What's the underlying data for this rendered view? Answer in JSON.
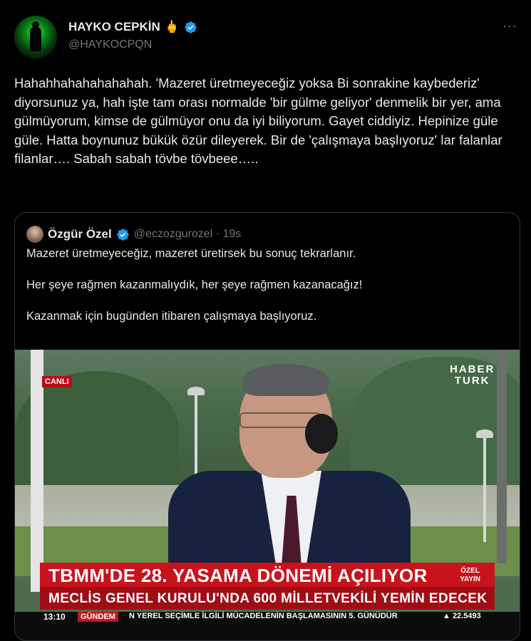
{
  "author": {
    "name": "HAYKO CEPKİN",
    "emoji": "🖕",
    "handle": "@HAYKOCPQN"
  },
  "more_label": "···",
  "tweet_text": "Hahahhahahahahahah. 'Mazeret üretmeyeceğiz yoksa Bi sonrakine kaybederiz' diyorsunuz ya, hah işte tam orası normalde 'bir gülme geliyor' denmelik bir yer, ama gülmüyorum, kimse de gülmüyor onu da iyi biliyorum. Gayet ciddiyiz. Hepinize güle güle. Hatta boynunuz bükük özür dileyerek. Bir de 'çalışmaya başlıyoruz' lar falanlar filanlar…. Sabah sabah tövbe tövbeee…..",
  "quote": {
    "name": "Özgür Özel",
    "handle": "@eczozgurozel · 19s",
    "lines": [
      "Mazeret üretmeyeceğiz, mazeret üretirsek bu sonuç tekrarlanır.",
      "Her şeye rağmen kazanmalıydık, her şeye rağmen kazanacağız!",
      "Kazanmak için bugünden itibaren çalışmaya başlıyoruz."
    ]
  },
  "video": {
    "live_badge": "CANLI",
    "channel_logo_line1": "HABER",
    "channel_logo_line2": "TURK",
    "headline": "TBMM'DE 28. YASAMA DÖNEMİ AÇILIYOR",
    "subheadline": "MECLİS GENEL KURULU'NDA 600 MİLLETVEKİLİ YEMİN EDECEK",
    "badge_line1": "ÖZEL",
    "badge_line2": "YAYIN",
    "ticker_time": "13:10",
    "ticker_label": "GÜNDEM",
    "ticker_text": "N YEREL SEÇİMLE İLGİLİ MÜCADELENİN BAŞLAMASININ 5. GÜNÜDÜR",
    "ticker_stock": "▲ 22.5493"
  },
  "colors": {
    "verified": "#1d9bf0",
    "background": "#000000",
    "text": "#e7e9ea",
    "muted": "#71767b",
    "border": "#2f3336",
    "news_red": "#c9131c"
  }
}
